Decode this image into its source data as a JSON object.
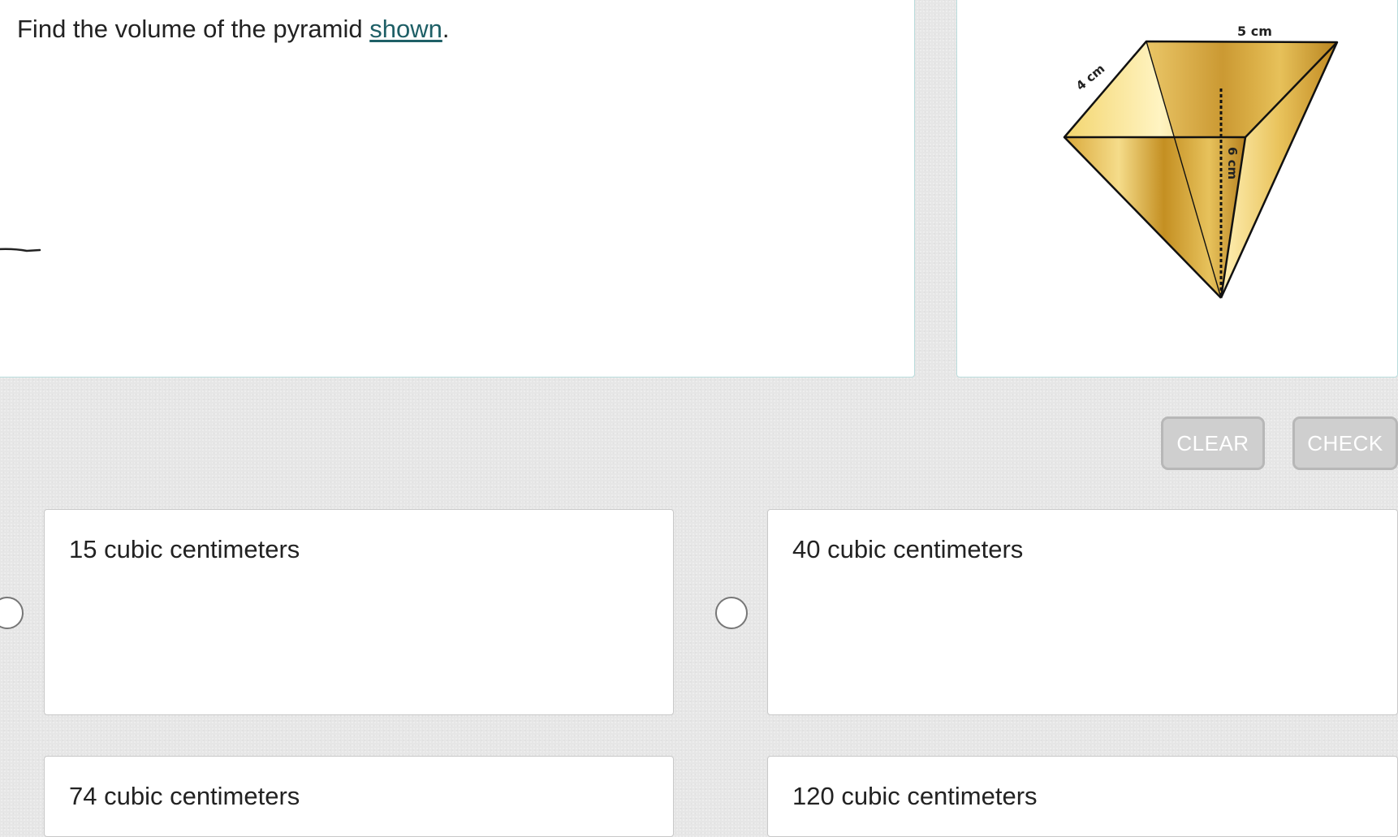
{
  "question": {
    "prefix": "Find the volume of the pyramid ",
    "link_text": "shown",
    "suffix": "."
  },
  "figure": {
    "label_top": "5 cm",
    "label_side": "4 cm",
    "label_height": "6 cm"
  },
  "buttons": {
    "clear": "CLEAR",
    "check": "CHECK"
  },
  "choices": [
    {
      "label": "15 cubic centimeters"
    },
    {
      "label": "40 cubic centimeters"
    },
    {
      "label": "74 cubic centimeters"
    },
    {
      "label": "120 cubic centimeters"
    }
  ],
  "colors": {
    "accent_link": "#1e5f66",
    "panel_border": "#b9dcdc",
    "button_bg": "#cfcfcf",
    "pyramid_gold": "#d9aa3c"
  }
}
